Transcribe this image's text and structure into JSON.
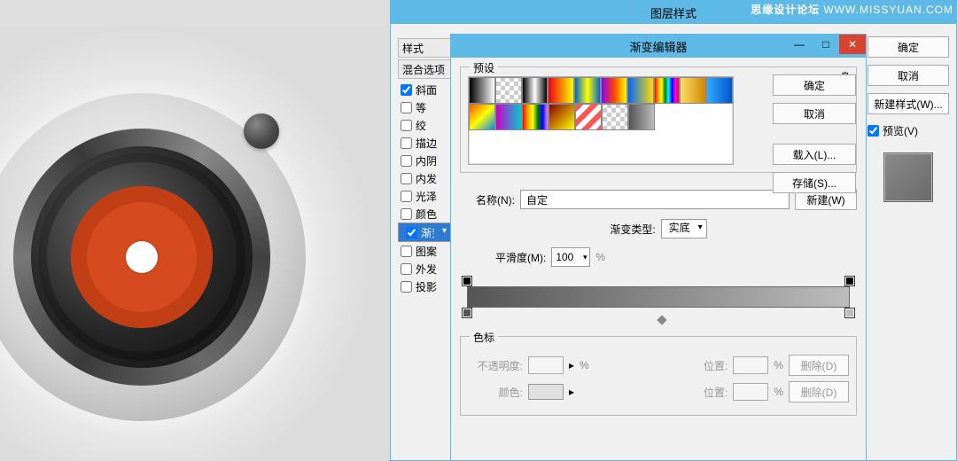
{
  "watermark": {
    "brand": "思缘设计论坛",
    "url": "WWW.MISSYUAN.COM"
  },
  "layerStyles": {
    "title": "图层样式",
    "stylesHeader": "样式",
    "blendHeader": "混合选项",
    "items": [
      {
        "label": "斜面",
        "checked": true
      },
      {
        "label": "等",
        "checked": false
      },
      {
        "label": "绞",
        "checked": false
      },
      {
        "label": "描边",
        "checked": false
      },
      {
        "label": "内阴",
        "checked": false
      },
      {
        "label": "内发",
        "checked": false
      },
      {
        "label": "光泽",
        "checked": false
      },
      {
        "label": "颜色",
        "checked": false
      },
      {
        "label": "渐变",
        "checked": true,
        "selected": true
      },
      {
        "label": "图案",
        "checked": false
      },
      {
        "label": "外发",
        "checked": false
      },
      {
        "label": "投影",
        "checked": false
      }
    ],
    "buttons": {
      "ok": "确定",
      "cancel": "取消",
      "newStyle": "新建样式(W)..."
    },
    "preview": {
      "label": "预览(V)",
      "checked": true
    }
  },
  "gradientEditor": {
    "title": "渐变编辑器",
    "presetsLabel": "预设",
    "gearIcon": "⚙",
    "swatches": [
      [
        "linear-gradient(90deg,#000,#fff)",
        "repeating-conic-gradient(#ccc 0 25%,#fff 0 50%) 0/10px 10px",
        "linear-gradient(90deg,#000,#fff,#000)",
        "linear-gradient(90deg,#e01,#ff0)",
        "linear-gradient(90deg,#06c,#ff0,#06c)",
        "linear-gradient(90deg,#80f,#f40,#ff0)",
        "linear-gradient(90deg,#06f,#fd0)",
        "linear-gradient(90deg,red,orange,yellow,green,cyan,blue,magenta,red)",
        "linear-gradient(90deg,#fd6,#c80)",
        "linear-gradient(90deg,#3af,#05c)"
      ],
      [
        "linear-gradient(135deg,#f50,#ff0,#08f)",
        "linear-gradient(90deg,#c0c,#0cc)",
        "linear-gradient(90deg,red,orange,yellow,green,blue,violet)",
        "linear-gradient(135deg,#800,#ff0)",
        "repeating-linear-gradient(135deg,#f55 0 6px,#fff 6px 12px)",
        "repeating-conic-gradient(#ccc 0 25%,#fff 0 50%) 0/10px 10px",
        "linear-gradient(90deg,#555,#888,#bcbcbc)"
      ]
    ],
    "buttons": {
      "ok": "确定",
      "cancel": "取消",
      "load": "载入(L)...",
      "save": "存储(S)..."
    },
    "name": {
      "label": "名称(N):",
      "value": "自定",
      "newBtn": "新建(W)"
    },
    "type": {
      "label": "渐变类型:",
      "value": "实底"
    },
    "smooth": {
      "label": "平滑度(M):",
      "value": "100",
      "unit": "%"
    },
    "stops": {
      "legend": "色标",
      "opacity": {
        "label": "不透明度:",
        "value": "",
        "unit": "%"
      },
      "position": {
        "label": "位置:",
        "value": "",
        "unit": "%"
      },
      "color": {
        "label": "颜色:"
      },
      "delete": "删除(D)"
    },
    "winMin": "—",
    "winMax": "□",
    "winClose": "✕"
  }
}
